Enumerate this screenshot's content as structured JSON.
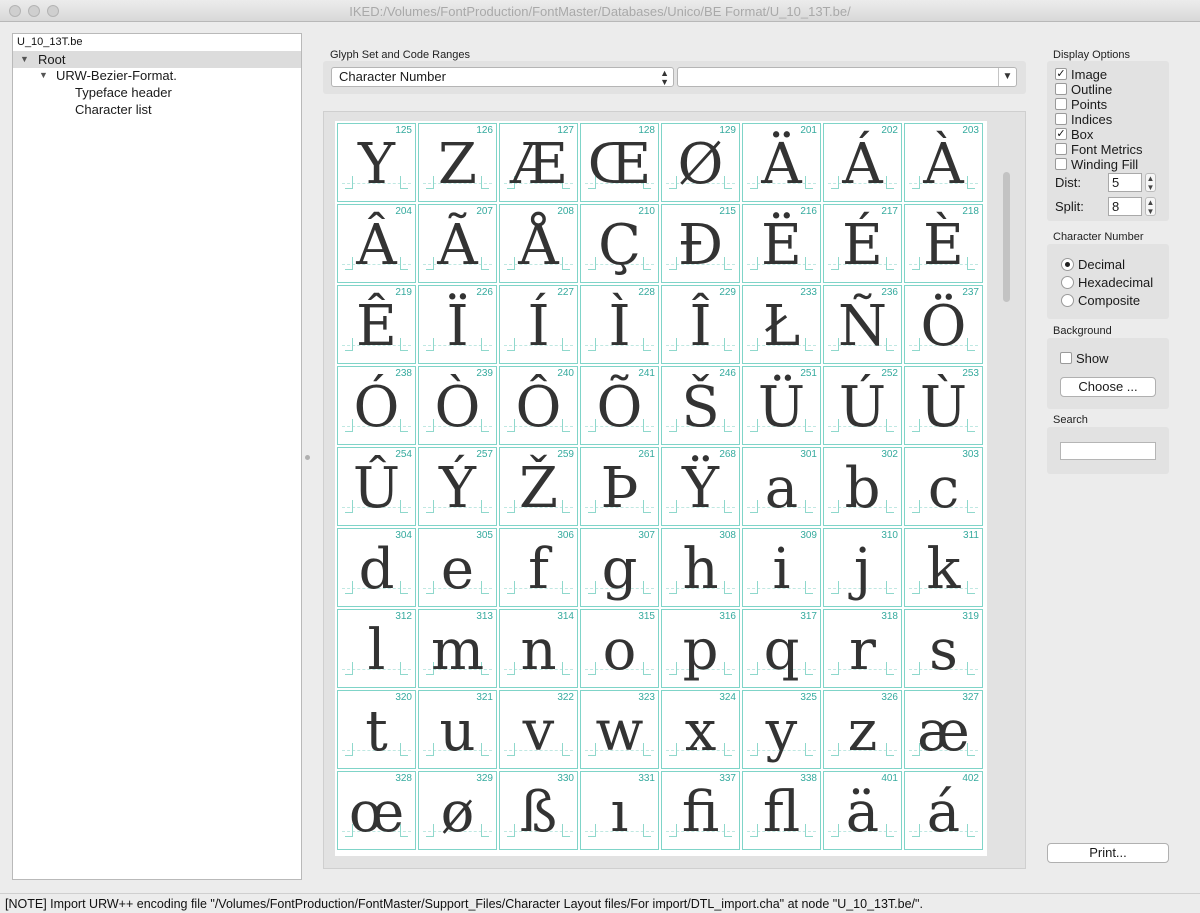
{
  "window": {
    "title": "IKED:/Volumes/FontProduction/FontMaster/Databases/Unico/BE Format/U_10_13T.be/"
  },
  "tree": {
    "file": "U_10_13T.be",
    "root": "Root",
    "format_node": "URW-Bezier-Format.",
    "children": [
      "Typeface header",
      "Character list"
    ]
  },
  "glyph_set": {
    "label": "Glyph Set and Code Ranges",
    "selected": "Character Number",
    "range_value": ""
  },
  "glyphs": [
    {
      "code": "125",
      "char": "Y"
    },
    {
      "code": "126",
      "char": "Z"
    },
    {
      "code": "127",
      "char": "Æ"
    },
    {
      "code": "128",
      "char": "Œ"
    },
    {
      "code": "129",
      "char": "Ø"
    },
    {
      "code": "201",
      "char": "Ä"
    },
    {
      "code": "202",
      "char": "Á"
    },
    {
      "code": "203",
      "char": "À"
    },
    {
      "code": "204",
      "char": "Â"
    },
    {
      "code": "207",
      "char": "Ã"
    },
    {
      "code": "208",
      "char": "Å"
    },
    {
      "code": "210",
      "char": "Ç"
    },
    {
      "code": "215",
      "char": "Đ"
    },
    {
      "code": "216",
      "char": "Ë"
    },
    {
      "code": "217",
      "char": "É"
    },
    {
      "code": "218",
      "char": "È"
    },
    {
      "code": "219",
      "char": "Ê"
    },
    {
      "code": "226",
      "char": "Ï"
    },
    {
      "code": "227",
      "char": "Í"
    },
    {
      "code": "228",
      "char": "Ì"
    },
    {
      "code": "229",
      "char": "Î"
    },
    {
      "code": "233",
      "char": "Ł"
    },
    {
      "code": "236",
      "char": "Ñ"
    },
    {
      "code": "237",
      "char": "Ö"
    },
    {
      "code": "238",
      "char": "Ó"
    },
    {
      "code": "239",
      "char": "Ò"
    },
    {
      "code": "240",
      "char": "Ô"
    },
    {
      "code": "241",
      "char": "Õ"
    },
    {
      "code": "246",
      "char": "Š"
    },
    {
      "code": "251",
      "char": "Ü"
    },
    {
      "code": "252",
      "char": "Ú"
    },
    {
      "code": "253",
      "char": "Ù"
    },
    {
      "code": "254",
      "char": "Û"
    },
    {
      "code": "257",
      "char": "Ý"
    },
    {
      "code": "259",
      "char": "Ž"
    },
    {
      "code": "261",
      "char": "Þ"
    },
    {
      "code": "268",
      "char": "Ÿ"
    },
    {
      "code": "301",
      "char": "a"
    },
    {
      "code": "302",
      "char": "b"
    },
    {
      "code": "303",
      "char": "c"
    },
    {
      "code": "304",
      "char": "d"
    },
    {
      "code": "305",
      "char": "e"
    },
    {
      "code": "306",
      "char": "f"
    },
    {
      "code": "307",
      "char": "g"
    },
    {
      "code": "308",
      "char": "h"
    },
    {
      "code": "309",
      "char": "i"
    },
    {
      "code": "310",
      "char": "j"
    },
    {
      "code": "311",
      "char": "k"
    },
    {
      "code": "312",
      "char": "l"
    },
    {
      "code": "313",
      "char": "m"
    },
    {
      "code": "314",
      "char": "n"
    },
    {
      "code": "315",
      "char": "o"
    },
    {
      "code": "316",
      "char": "p"
    },
    {
      "code": "317",
      "char": "q"
    },
    {
      "code": "318",
      "char": "r"
    },
    {
      "code": "319",
      "char": "s"
    },
    {
      "code": "320",
      "char": "t"
    },
    {
      "code": "321",
      "char": "u"
    },
    {
      "code": "322",
      "char": "v"
    },
    {
      "code": "323",
      "char": "w"
    },
    {
      "code": "324",
      "char": "x"
    },
    {
      "code": "325",
      "char": "y"
    },
    {
      "code": "326",
      "char": "z"
    },
    {
      "code": "327",
      "char": "æ"
    },
    {
      "code": "328",
      "char": "œ"
    },
    {
      "code": "329",
      "char": "ø"
    },
    {
      "code": "330",
      "char": "ß"
    },
    {
      "code": "331",
      "char": "ı"
    },
    {
      "code": "337",
      "char": "fi"
    },
    {
      "code": "338",
      "char": "fl"
    },
    {
      "code": "401",
      "char": "ä"
    },
    {
      "code": "402",
      "char": "á"
    }
  ],
  "display_options": {
    "label": "Display Options",
    "items": [
      {
        "label": "Image",
        "checked": true
      },
      {
        "label": "Outline",
        "checked": false
      },
      {
        "label": "Points",
        "checked": false
      },
      {
        "label": "Indices",
        "checked": false
      },
      {
        "label": "Box",
        "checked": true
      },
      {
        "label": "Font Metrics",
        "checked": false
      },
      {
        "label": "Winding Fill",
        "checked": false
      }
    ],
    "dist_label": "Dist:",
    "dist_value": "5",
    "split_label": "Split:",
    "split_value": "8"
  },
  "character_number": {
    "label": "Character Number",
    "options": [
      {
        "label": "Decimal",
        "selected": true
      },
      {
        "label": "Hexadecimal",
        "selected": false
      },
      {
        "label": "Composite",
        "selected": false
      }
    ]
  },
  "background": {
    "label": "Background",
    "show_label": "Show",
    "show_checked": false,
    "choose_label": "Choose ..."
  },
  "search": {
    "label": "Search",
    "value": ""
  },
  "print_label": "Print...",
  "status": "[NOTE] Import URW++ encoding file \"/Volumes/FontProduction/FontMaster/Support_Files/Character Layout files/For import/DTL_import.cha\" at node \"U_10_13T.be/\".",
  "colors": {
    "cell_border": "#7fd4c8",
    "code_text": "#35aa9e",
    "glyph": "#333333"
  }
}
